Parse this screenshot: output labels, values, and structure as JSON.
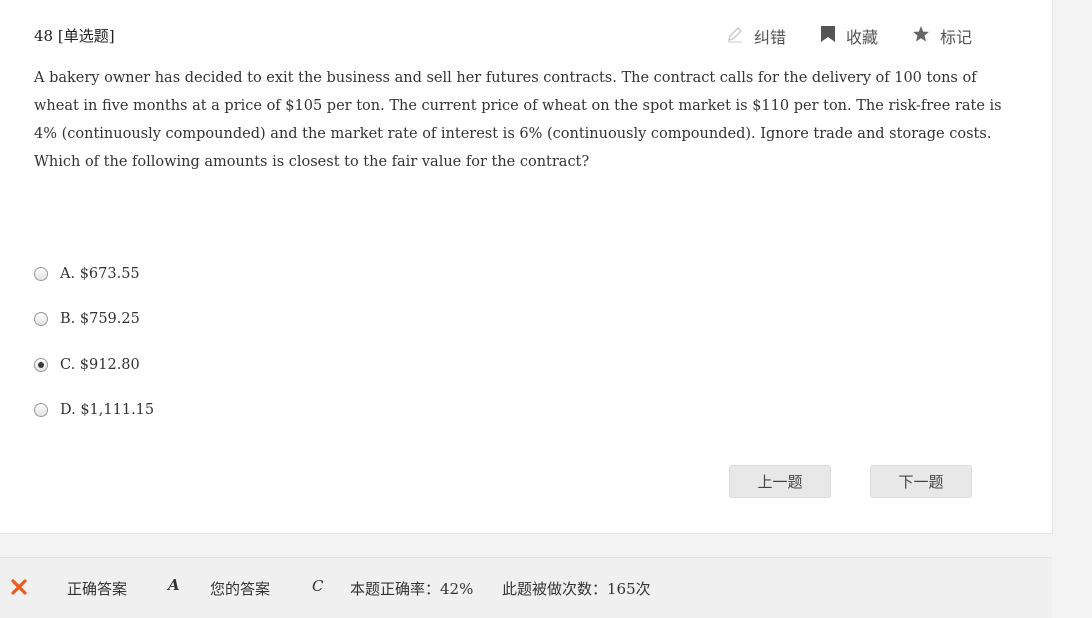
{
  "question": {
    "number_label": "48 [单选题]",
    "text": "A bakery owner has decided to exit the business and sell her futures contracts. The contract calls for the delivery of 100 tons of wheat in five months at a price of $105 per ton. The current price of wheat on the spot market is $110 per ton. The risk-free rate is 4% (continuously compounded) and the market rate of interest is 6% (continuously compounded). Ignore trade and storage costs. Which of the following amounts is closest to the fair value for the contract?"
  },
  "tools": {
    "report_label": "纠错",
    "favorite_label": "收藏",
    "mark_label": "标记"
  },
  "options": [
    {
      "label": "A. $673.55",
      "selected": false
    },
    {
      "label": "B. $759.25",
      "selected": false
    },
    {
      "label": "C. $912.80",
      "selected": true
    },
    {
      "label": "D. $1,111.15",
      "selected": false
    }
  ],
  "nav": {
    "prev_label": "上一题",
    "next_label": "下一题"
  },
  "result": {
    "status_icon": "wrong-x-icon",
    "correct_answer_label": "正确答案",
    "correct_answer": "A",
    "your_answer_label": "您的答案",
    "your_answer": "C",
    "accuracy_text": "本题正确率：42%",
    "attempts_text": "此题被做次数：165次"
  },
  "colors": {
    "correct": "#2bb84a",
    "yours": "#e0651e",
    "wrong_icon": "#ef5a1f"
  }
}
